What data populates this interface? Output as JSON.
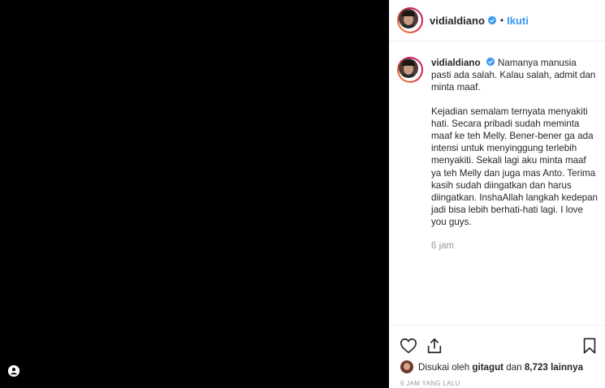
{
  "post": {
    "username": "vidialdiano",
    "separator": "•",
    "follow_label": "Ikuti",
    "caption_para1": "Namanya manusia pasti ada salah. Kalau salah, admit dan minta maaf.",
    "caption_para2": "Kejadian semalam ternyata menyakiti hati. Secara pribadi sudah meminta maaf ke teh Melly. Bener-bener ga ada intensi untuk menyinggung terlebih menyakiti. Sekali lagi aku minta maaf ya teh Melly dan juga mas Anto. Terima kasih sudah diingatkan dan harus diingatkan. InshaAllah langkah kedepan jadi bisa lebih berhati-hati lagi. I love you guys.",
    "comment_time": "6 jam",
    "liked_by_prefix": "Disukai oleh",
    "liked_by_user": "gitagut",
    "liked_by_and": "dan",
    "likes_count": "8,723 lainnya",
    "timestamp": "6 JAM YANG LALU"
  },
  "icons": {
    "verified": "verified-badge-icon",
    "like": "heart-icon",
    "share": "share-icon",
    "save": "bookmark-icon",
    "tag": "user-tag-icon"
  },
  "colors": {
    "media_bg": "#000000",
    "link_blue": "#3897f0",
    "verified_blue": "#3897f0",
    "muted": "#999999"
  }
}
